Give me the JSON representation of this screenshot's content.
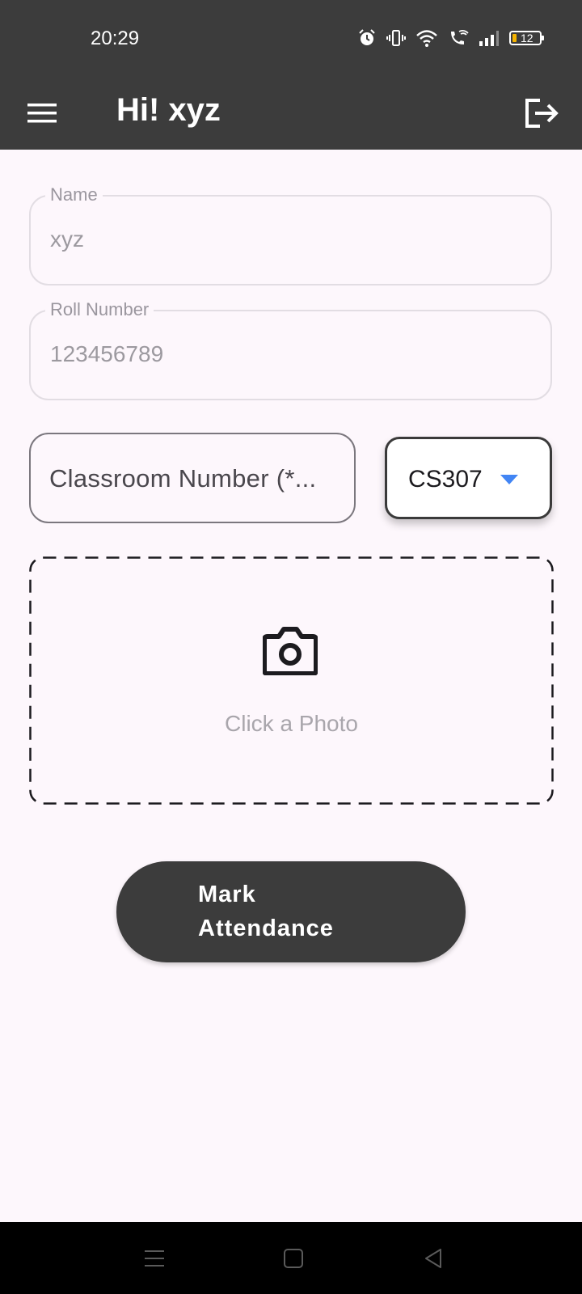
{
  "status_bar": {
    "time": "20:29",
    "icons": [
      "alarm-icon",
      "vibrate-icon",
      "wifi-icon",
      "wifi-calling-icon",
      "signal-icon",
      "battery-icon"
    ],
    "battery_percent": "12"
  },
  "app_bar": {
    "title": "Hi! xyz",
    "menu_icon": "hamburger-menu-icon",
    "logout_icon": "logout-icon"
  },
  "form": {
    "name": {
      "label": "Name",
      "value": "xyz"
    },
    "roll_number": {
      "label": "Roll Number",
      "value": "123456789"
    },
    "classroom": {
      "placeholder": "Classroom Number (*..."
    },
    "classroom_dropdown": {
      "selected": "CS307",
      "arrow_color": "#4285f4"
    }
  },
  "photo": {
    "icon": "camera-icon",
    "label": "Click a Photo"
  },
  "submit_button": {
    "label": "Mark Attendance"
  },
  "nav_bar": {
    "icons": [
      "recents-icon",
      "home-icon",
      "back-icon"
    ]
  },
  "colors": {
    "app_bar": "#3c3c3c",
    "background": "#fdf7fc",
    "button": "#3c3c3c",
    "dropdown_arrow": "#4285f4"
  }
}
